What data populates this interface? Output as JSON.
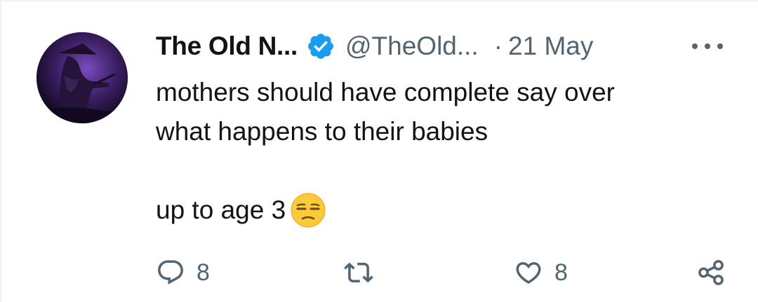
{
  "tweet": {
    "display_name": "The Old N...",
    "handle": "@TheOld...",
    "separator": "·",
    "timestamp": "21 May",
    "text_line_1": "mothers should have complete say over",
    "text_line_2": "what happens to their babies",
    "text_line_3": "up to age 3"
  },
  "actions": {
    "reply_count": "8",
    "like_count": "8"
  },
  "icons": {
    "verified": "verified-badge-icon",
    "emoji": "unamused-face-emoji",
    "reply": "reply-icon",
    "retweet": "retweet-icon",
    "like": "heart-icon",
    "share": "share-icon",
    "more": "more-dots-icon"
  },
  "colors": {
    "text_primary": "#0f1419",
    "text_secondary": "#536471",
    "verified_blue": "#1d9bf0"
  }
}
